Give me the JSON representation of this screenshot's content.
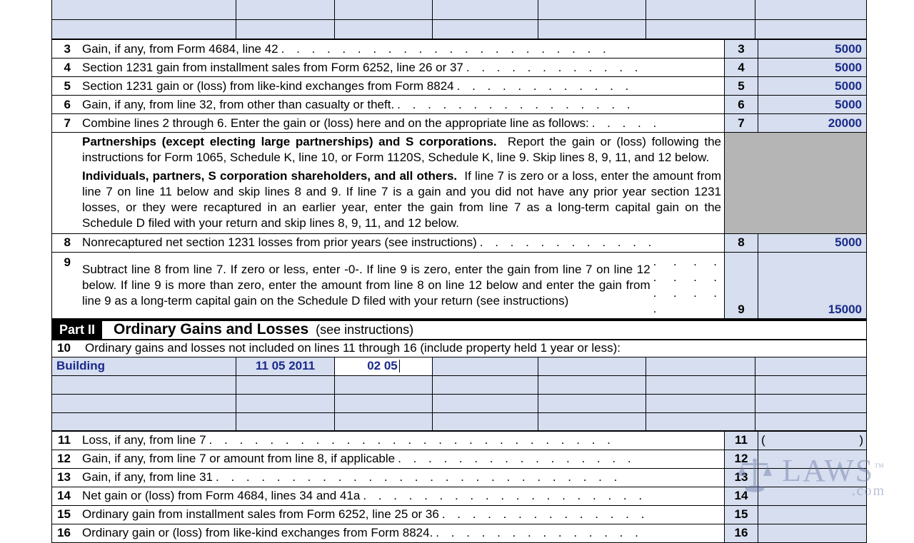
{
  "lines": {
    "l3": {
      "num": "3",
      "text": "Gain, if any, from Form 4684, line 42",
      "box": "3",
      "val": "5000"
    },
    "l4": {
      "num": "4",
      "text": "Section 1231 gain from installment sales from Form 6252, line 26 or 37",
      "box": "4",
      "val": "5000"
    },
    "l5": {
      "num": "5",
      "text": "Section 1231 gain or (loss) from like-kind exchanges from Form 8824",
      "box": "5",
      "val": "5000"
    },
    "l6": {
      "num": "6",
      "text": "Gain, if any, from line 32, from other than casualty or theft.",
      "box": "6",
      "val": "5000"
    },
    "l7": {
      "num": "7",
      "text": "Combine lines 2 through 6. Enter the gain or (loss) here and on the appropriate line as follows:",
      "box": "7",
      "val": "20000"
    },
    "l8": {
      "num": "8",
      "text": "Nonrecaptured net section 1231 losses from prior years (see instructions)",
      "box": "8",
      "val": "5000"
    },
    "l9": {
      "num": "9",
      "text": "Subtract line 8 from line 7. If zero or less, enter -0-. If line 9 is zero, enter the gain from line 7 on line 12 below. If line 9 is more than zero, enter the amount from line 8 on line 12 below and enter the gain from line 9 as a long-term capital gain on the Schedule D filed with your return (see instructions)",
      "box": "9",
      "val": "15000"
    },
    "l11": {
      "num": "11",
      "text": "Loss, if any, from line 7",
      "box": "11",
      "val": ""
    },
    "l12": {
      "num": "12",
      "text": "Gain, if any, from line 7 or amount from line 8, if applicable",
      "box": "12",
      "val": ""
    },
    "l13": {
      "num": "13",
      "text": "Gain, if any, from line 31",
      "box": "13",
      "val": ""
    },
    "l14": {
      "num": "14",
      "text": "Net gain or (loss) from Form 4684, lines 34 and 41a",
      "box": "14",
      "val": ""
    },
    "l15": {
      "num": "15",
      "text": "Ordinary gain from installment sales from Form 6252, line 25 or 36",
      "box": "15",
      "val": ""
    },
    "l16": {
      "num": "16",
      "text": "Ordinary gain or (loss) from like-kind exchanges from Form 8824.",
      "box": "16",
      "val": ""
    }
  },
  "instructions": {
    "p1_bold": "Partnerships (except electing large partnerships) and S corporations.",
    "p1_text": "Report the gain or (loss) following the instructions for Form 1065, Schedule K, line 10, or Form 1120S, Schedule K, line 9. Skip lines 8, 9, 11, and 12 below.",
    "p2_bold": "Individuals, partners, S corporation shareholders, and all others.",
    "p2_text": "If line 7 is zero or a loss, enter the amount from line 7 on line 11 below and skip lines 8 and 9. If line 7 is a gain and you did not have any prior year section 1231 losses, or they were recaptured in an earlier year, enter the gain from line 7 as a long-term capital gain on the Schedule D filed with your return and skip lines 8, 9, 11, and 12 below."
  },
  "part2": {
    "label": "Part II",
    "title": "Ordinary Gains and Losses",
    "sub": "(see instructions)"
  },
  "line10": {
    "num": "10",
    "text": "Ordinary gains and losses not included on lines 11 through 16 (include property held 1 year or less):"
  },
  "entry": {
    "desc": "Building",
    "date_acq": "11 05 2011",
    "date_sold": "02 05"
  },
  "watermark": {
    "text": "LAWS",
    "tm": "™",
    "sub": ".com"
  }
}
